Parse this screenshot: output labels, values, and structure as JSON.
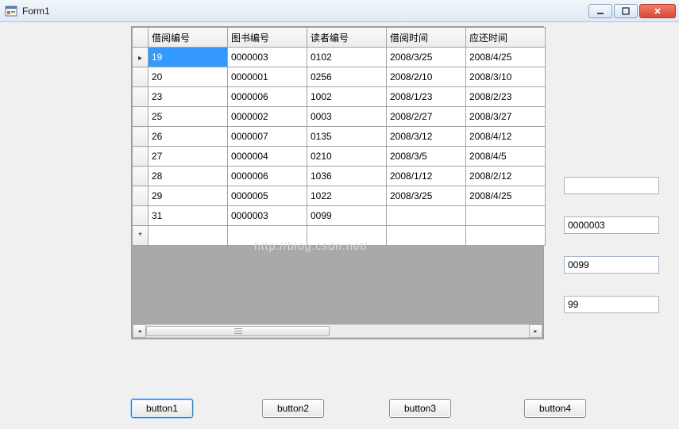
{
  "window": {
    "title": "Form1"
  },
  "grid": {
    "columns": [
      "借阅编号",
      "图书编号",
      "读者编号",
      "借阅时间",
      "应还时间"
    ],
    "rows": [
      {
        "c0": "19",
        "c1": "0000003",
        "c2": "0102",
        "c3": "2008/3/25",
        "c4": "2008/4/25"
      },
      {
        "c0": "20",
        "c1": "0000001",
        "c2": "0256",
        "c3": "2008/2/10",
        "c4": "2008/3/10"
      },
      {
        "c0": "23",
        "c1": "0000006",
        "c2": "1002",
        "c3": "2008/1/23",
        "c4": "2008/2/23"
      },
      {
        "c0": "25",
        "c1": "0000002",
        "c2": "0003",
        "c3": "2008/2/27",
        "c4": "2008/3/27"
      },
      {
        "c0": "26",
        "c1": "0000007",
        "c2": "0135",
        "c3": "2008/3/12",
        "c4": "2008/4/12"
      },
      {
        "c0": "27",
        "c1": "0000004",
        "c2": "0210",
        "c3": "2008/3/5",
        "c4": "2008/4/5"
      },
      {
        "c0": "28",
        "c1": "0000006",
        "c2": "1036",
        "c3": "2008/1/12",
        "c4": "2008/2/12"
      },
      {
        "c0": "29",
        "c1": "0000005",
        "c2": "1022",
        "c3": "2008/3/25",
        "c4": "2008/4/25"
      },
      {
        "c0": "31",
        "c1": "0000003",
        "c2": "0099",
        "c3": "",
        "c4": ""
      }
    ]
  },
  "inputs": {
    "tb1": "",
    "tb2": "0000003",
    "tb3": "0099",
    "tb4": "99"
  },
  "buttons": {
    "b1": "button1",
    "b2": "button2",
    "b3": "button3",
    "b4": "button4"
  },
  "watermark": "http://blog.csdn.net/"
}
